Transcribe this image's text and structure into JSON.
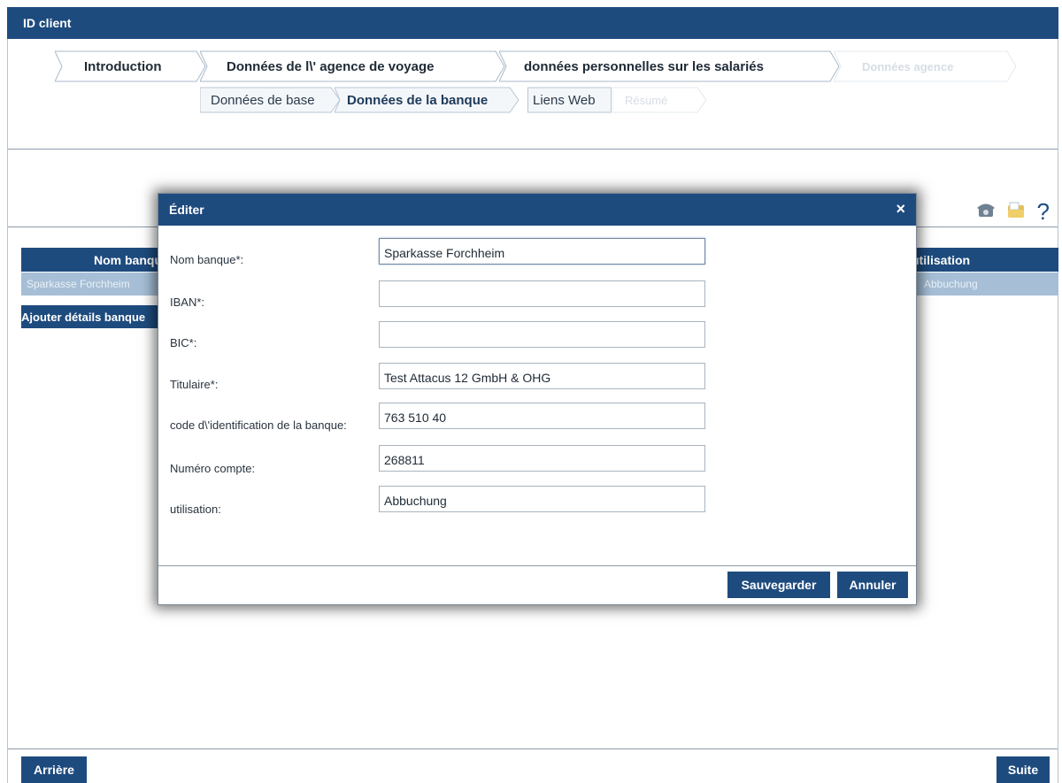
{
  "window": {
    "title": "ID client"
  },
  "wizard": {
    "steps": [
      {
        "label": "Introduction"
      },
      {
        "label": "Données de l\\' agence de voyage"
      },
      {
        "label": "données personnelles sur les salariés"
      },
      {
        "label": "Données agence"
      }
    ],
    "substeps": [
      {
        "label": "Données de base"
      },
      {
        "label": "Données de la banque"
      },
      {
        "label": "Liens Web"
      },
      {
        "label": "Résumé"
      }
    ]
  },
  "utility": {
    "help_label": "?",
    "icons": [
      "phone-icon",
      "folder-icon",
      "help-icon"
    ]
  },
  "table": {
    "headers": [
      "Nom banque",
      "utilisation"
    ],
    "rows": [
      {
        "name": "Sparkasse Forchheim",
        "usage": "Abbuchung"
      }
    ]
  },
  "add_button_label": "Ajouter détails banque",
  "nav": {
    "back_label": "Arrière",
    "next_label": "Suite"
  },
  "modal": {
    "title": "Éditer",
    "close_glyph": "×",
    "fields": {
      "bank_name": {
        "label": "Nom banque*:",
        "value": "Sparkasse Forchheim"
      },
      "iban": {
        "label": "IBAN*:",
        "value": ""
      },
      "bic": {
        "label": "BIC*:",
        "value": ""
      },
      "holder": {
        "label": "Titulaire*:",
        "value": "Test Attacus 12 GmbH & OHG"
      },
      "bank_code": {
        "label": "code d\\'identification de la banque:",
        "value": "763 510 40"
      },
      "account_number": {
        "label": "Numéro compte:",
        "value": "268811"
      },
      "usage": {
        "label": "utilisation:",
        "value": "Abbuchung"
      }
    },
    "save_label": "Sauvegarder",
    "cancel_label": "Annuler"
  },
  "colors": {
    "primary": "#1e4b7e",
    "row_selected": "#a6bfd6"
  }
}
